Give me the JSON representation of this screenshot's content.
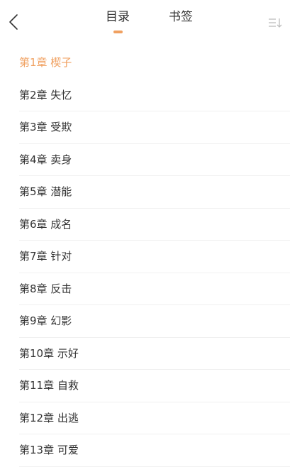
{
  "header": {
    "tabs": [
      {
        "label": "目录",
        "active": true
      },
      {
        "label": "书签",
        "active": false
      }
    ],
    "back_icon": "chevron-left-icon",
    "sort_icon": "sort-order-icon"
  },
  "accent_color": "#f0a060",
  "chapters": [
    {
      "label": "第1章 楔子",
      "active": true
    },
    {
      "label": "第2章 失忆",
      "active": false
    },
    {
      "label": "第3章 受欺",
      "active": false
    },
    {
      "label": "第4章 卖身",
      "active": false
    },
    {
      "label": "第5章 潜能",
      "active": false
    },
    {
      "label": "第6章 成名",
      "active": false
    },
    {
      "label": "第7章 针对",
      "active": false
    },
    {
      "label": "第8章 反击",
      "active": false
    },
    {
      "label": "第9章 幻影",
      "active": false
    },
    {
      "label": "第10章 示好",
      "active": false
    },
    {
      "label": "第11章 自救",
      "active": false
    },
    {
      "label": "第12章 出逃",
      "active": false
    },
    {
      "label": "第13章 可爱",
      "active": false
    }
  ]
}
